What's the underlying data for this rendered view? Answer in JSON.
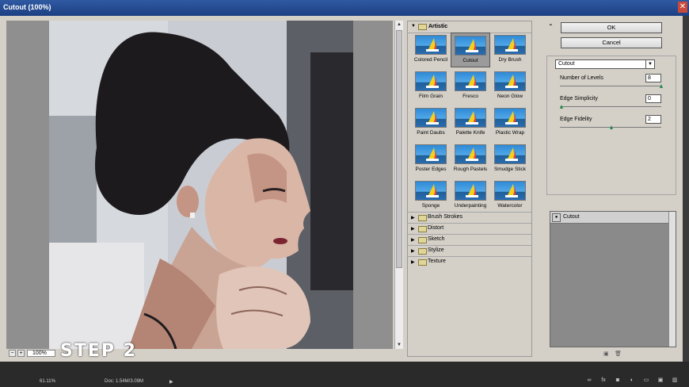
{
  "window": {
    "title": "Cutout (100%)",
    "close_glyph": "✕"
  },
  "preview": {
    "zoom": "100%",
    "minus": "−",
    "plus": "+",
    "scroll_up": "▲",
    "scroll_down": "▼"
  },
  "gallery": {
    "category": "Artistic",
    "thumbnails": [
      {
        "label": "Colored Pencil"
      },
      {
        "label": "Cutout",
        "selected": true
      },
      {
        "label": "Dry Brush"
      },
      {
        "label": "Film Grain"
      },
      {
        "label": "Fresco"
      },
      {
        "label": "Neon Glow"
      },
      {
        "label": "Paint Daubs"
      },
      {
        "label": "Palette Knife"
      },
      {
        "label": "Plastic Wrap"
      },
      {
        "label": "Poster Edges"
      },
      {
        "label": "Rough Pastels"
      },
      {
        "label": "Smudge Stick"
      },
      {
        "label": "Sponge"
      },
      {
        "label": "Underpainting"
      },
      {
        "label": "Watercolor"
      }
    ],
    "categories": [
      "Brush Strokes",
      "Distort",
      "Sketch",
      "Stylize",
      "Texture"
    ]
  },
  "controls": {
    "ok_label": "OK",
    "cancel_label": "Cancel",
    "filter_selected": "Cutout",
    "params": [
      {
        "label": "Number of Levels",
        "value": "8",
        "slider_fraction": 1.0
      },
      {
        "label": "Edge Simplicity",
        "value": "0",
        "slider_fraction": 0.0
      },
      {
        "label": "Edge Fidelity",
        "value": "2",
        "slider_fraction": 0.5
      }
    ],
    "layer_name": "Cutout"
  },
  "status": {
    "zoom": "61.11%",
    "doc": "Doc: 1.54M/3.09M"
  },
  "overlay": {
    "step_text": "STEP 2"
  },
  "colors": {
    "title_bar": "#2f5aa3",
    "dialog_bg": "#d4d0c8",
    "slider_knob": "#1e8c4e"
  }
}
